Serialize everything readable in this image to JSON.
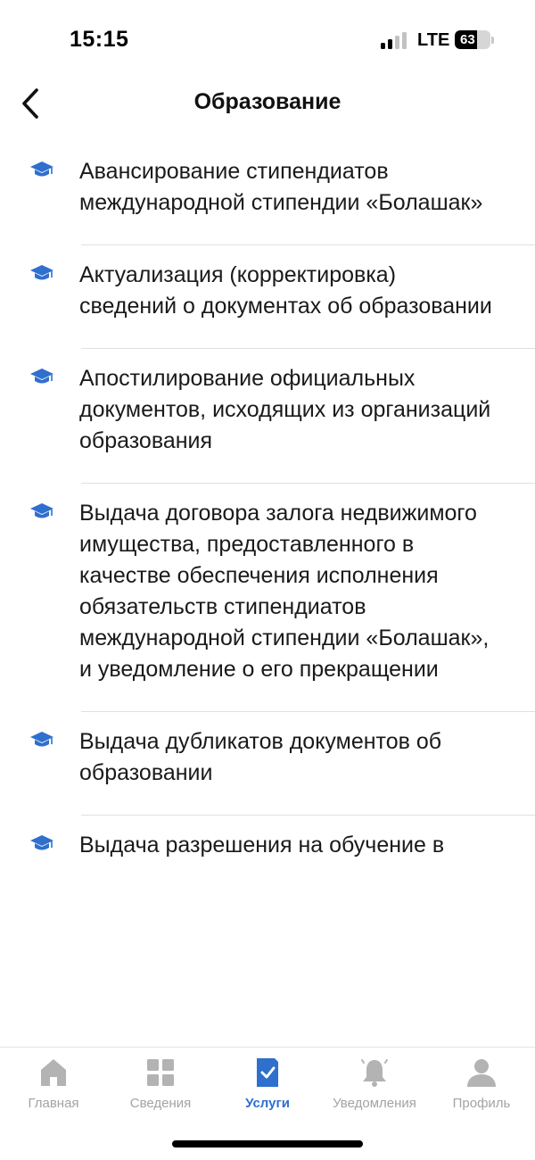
{
  "status_bar": {
    "time": "15:15",
    "network": "LTE",
    "battery_percent": "63",
    "signal_bars_active": 2,
    "signal_bars_total": 4
  },
  "nav": {
    "title": "Образование",
    "back_icon": "chevron-left-icon"
  },
  "colors": {
    "accent": "#2f6fce",
    "inactive": "#a3a3a3",
    "icon_blue": "#2f6fce"
  },
  "services": {
    "item_icon": "graduation-cap-icon",
    "items": [
      {
        "label": "Авансирование стипендиатов международной стипендии «Болашак»"
      },
      {
        "label": "Актуализация (корректировка) сведений о документах об образовании"
      },
      {
        "label": "Апостилирование официальных документов, исходящих из организаций образования"
      },
      {
        "label": "Выдача договора залога недвижимого имущества, предоставленного в качестве обеспечения исполнения обязательств стипендиатов международной стипендии «Болашак», и уведомление о его прекращении"
      },
      {
        "label": "Выдача дубликатов документов об образовании"
      },
      {
        "label": "Выдача разрешения на обучение в"
      }
    ]
  },
  "tab_bar": {
    "active_index": 2,
    "tabs": [
      {
        "label": "Главная",
        "icon": "home-icon"
      },
      {
        "label": "Сведения",
        "icon": "grid-icon"
      },
      {
        "label": "Услуги",
        "icon": "services-check-icon"
      },
      {
        "label": "Уведомления",
        "icon": "bell-icon"
      },
      {
        "label": "Профиль",
        "icon": "profile-icon"
      }
    ]
  }
}
